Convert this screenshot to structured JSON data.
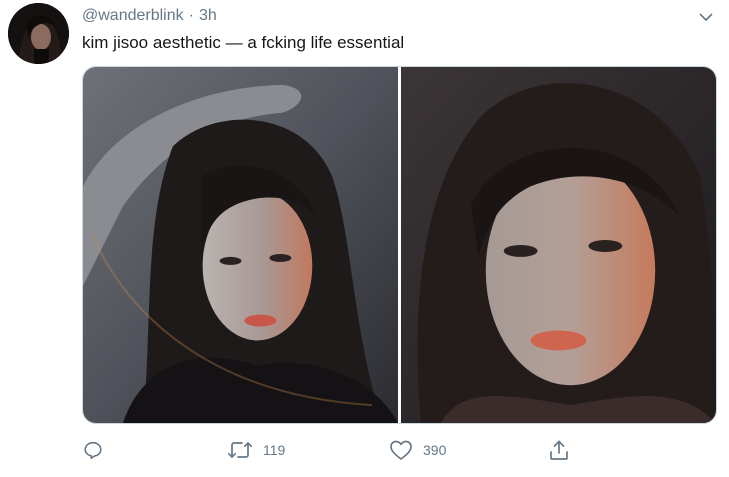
{
  "tweet": {
    "handle": "@wanderblink",
    "separator": "·",
    "time": "3h",
    "text": "kim jisoo aesthetic — a fcking life essential",
    "media": [
      {
        "alt": "photo-1"
      },
      {
        "alt": "photo-2"
      }
    ]
  },
  "actions": {
    "reply_count": "",
    "retweet_count": "119",
    "like_count": "390",
    "share_count": ""
  },
  "icons": {
    "reply": "reply-icon",
    "retweet": "retweet-icon",
    "like": "heart-icon",
    "share": "share-icon",
    "menu": "chevron-down-icon"
  },
  "colors": {
    "secondary_text": "#657786",
    "primary_text": "#14171a",
    "border": "#ccd6dd"
  }
}
